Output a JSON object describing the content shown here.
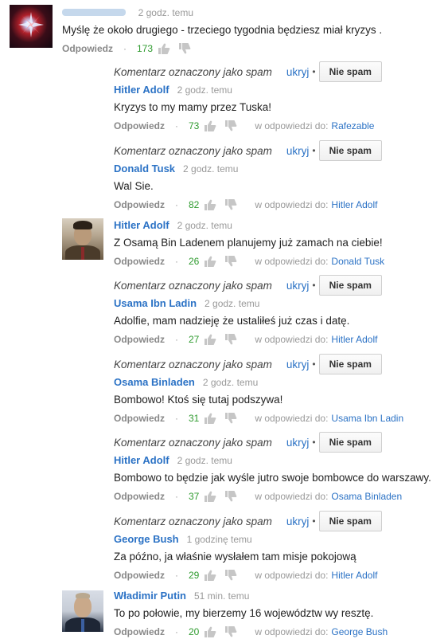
{
  "colors": {
    "link": "#2b72c5",
    "likes": "#2f9b2f",
    "muted": "#999999"
  },
  "top_comment": {
    "time": "2 godz. temu",
    "text": "Myślę że około drugiego - trzeciego tygodnia będziesz miał kryzys .",
    "reply_label": "Odpowiedz",
    "likes": "173"
  },
  "spam_notice": {
    "label": "Komentarz oznaczony jako spam",
    "hide": "ukryj",
    "dot": "•",
    "not_spam": "Nie spam"
  },
  "replies": [
    {
      "author": "Hitler Adolf",
      "time": "2 godz. temu",
      "text": "Kryzys to my mamy przez Tuska!",
      "reply_label": "Odpowiedz",
      "likes": "73",
      "reply_to_label": "w odpowiedzi do:",
      "reply_to": "Rafezable"
    },
    {
      "author": "Donald Tusk",
      "time": "2 godz. temu",
      "text": "Wal Sie.",
      "reply_label": "Odpowiedz",
      "likes": "82",
      "reply_to_label": "w odpowiedzi do:",
      "reply_to": "Hitler Adolf"
    },
    {
      "author": "Hitler Adolf",
      "time": "2 godz. temu",
      "text": "Z Osamą Bin Ladenem planujemy już zamach na ciebie!",
      "reply_label": "Odpowiedz",
      "likes": "26",
      "reply_to_label": "w odpowiedzi do:",
      "reply_to": "Donald Tusk"
    },
    {
      "author": "Usama Ibn Ladin",
      "time": "2 godz. temu",
      "text": "Adolfie, mam nadzieję że ustaliłeś już czas i datę.",
      "reply_label": "Odpowiedz",
      "likes": "27",
      "reply_to_label": "w odpowiedzi do:",
      "reply_to": "Hitler Adolf"
    },
    {
      "author": "Osama Binladen",
      "time": "2 godz. temu",
      "text": "Bombowo! Ktoś się tutaj podszywa!",
      "reply_label": "Odpowiedz",
      "likes": "31",
      "reply_to_label": "w odpowiedzi do:",
      "reply_to": "Usama Ibn Ladin"
    },
    {
      "author": "Hitler Adolf",
      "time": "2 godz. temu",
      "text": "Bombowo to będzie jak wyśle jutro swoje bombowce do warszawy.",
      "reply_label": "Odpowiedz",
      "likes": "37",
      "reply_to_label": "w odpowiedzi do:",
      "reply_to": "Osama Binladen"
    },
    {
      "author": "George Bush",
      "time": "1 godzinę temu",
      "text": "Za późno, ja właśnie wysłałem tam misje pokojową",
      "reply_label": "Odpowiedz",
      "likes": "29",
      "reply_to_label": "w odpowiedzi do:",
      "reply_to": "Hitler Adolf"
    },
    {
      "author": "Władimir Putin",
      "time": "51 min. temu",
      "text": "To po połowie, my bierzemy 16 województw wy resztę.",
      "reply_label": "Odpowiedz",
      "likes": "20",
      "reply_to_label": "w odpowiedzi do:",
      "reply_to": "George Bush"
    }
  ]
}
